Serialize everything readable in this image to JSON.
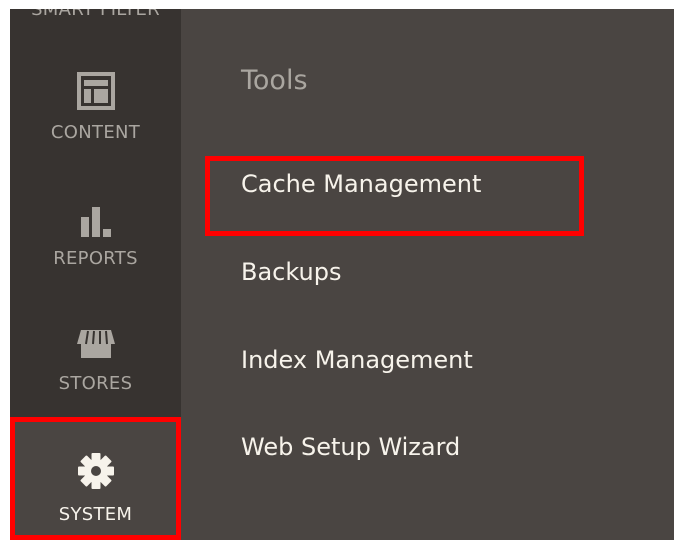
{
  "sidebar": {
    "items": [
      {
        "label": "SMART FILTER",
        "icon": "filter-icon"
      },
      {
        "label": "CONTENT",
        "icon": "layout-icon"
      },
      {
        "label": "REPORTS",
        "icon": "bar-chart-icon"
      },
      {
        "label": "STORES",
        "icon": "storefront-icon"
      },
      {
        "label": "SYSTEM",
        "icon": "gear-icon",
        "active": true
      }
    ]
  },
  "flyout": {
    "title": "Tools",
    "links": [
      "Cache Management",
      "Backups",
      "Index Management",
      "Web Setup Wizard"
    ]
  },
  "colors": {
    "sidebar_bg": "#373330",
    "flyout_bg": "#4a4542",
    "text_muted": "#aaa6a0",
    "text_light": "#f7f3eb",
    "highlight": "#ff0000"
  }
}
